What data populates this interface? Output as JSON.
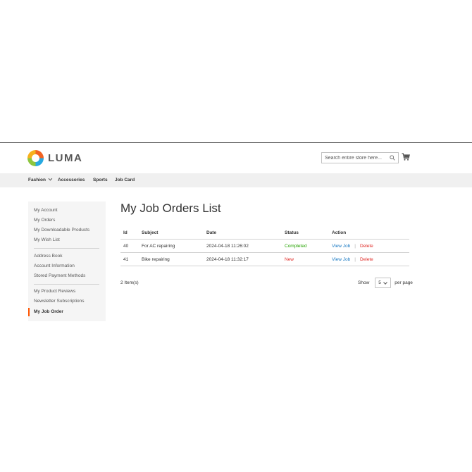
{
  "header": {
    "logo_text": "LUMA",
    "search_placeholder": "Search entire store here...",
    "icons": [
      "search-icon",
      "cart-icon"
    ]
  },
  "nav": {
    "items": [
      {
        "label": "Fashion",
        "has_dropdown": true
      },
      {
        "label": "Accessories"
      },
      {
        "label": "Sports"
      },
      {
        "label": "Job Card"
      }
    ]
  },
  "sidebar": {
    "groups": [
      [
        "My Account",
        "My Orders",
        "My Downloadable Products",
        "My Wish List"
      ],
      [
        "Address Book",
        "Account Information",
        "Stored Payment Methods"
      ],
      [
        "My Product Reviews",
        "Newsletter Subscriptions",
        "My Job Order"
      ]
    ],
    "active": "My Job Order",
    "accent": "#ff5501"
  },
  "main": {
    "title": "My Job Orders List",
    "columns": [
      "Id",
      "Subject",
      "Date",
      "Status",
      "Action"
    ],
    "rows": [
      {
        "id": "40",
        "subject": "For AC repairing",
        "date": "2024-04-18 11:26:02",
        "status": "Completed",
        "view": "View Job",
        "delete": "Delete"
      },
      {
        "id": "41",
        "subject": "Bike repairing",
        "date": "2024-04-18 11:32:17",
        "status": "New",
        "view": "View Job",
        "delete": "Delete"
      }
    ],
    "item_count": "2 Item(s)",
    "limiter": {
      "show_label": "Show",
      "value": "5",
      "per_page_label": "per page"
    }
  },
  "colors": {
    "status_completed": "#25a300",
    "status_new": "#e02b27",
    "link": "#1979c3",
    "delete": "#e02b27"
  }
}
